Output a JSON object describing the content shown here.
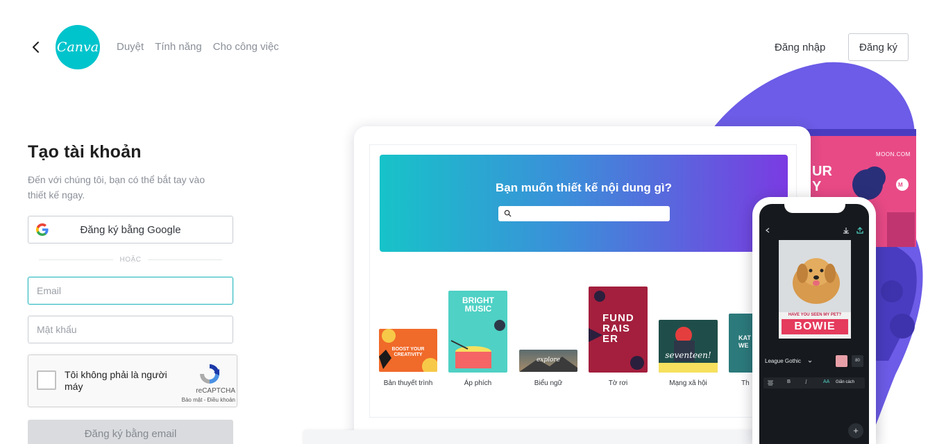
{
  "nav": {
    "logo_text": "Canva",
    "links": [
      "Duyệt",
      "Tính năng",
      "Cho công việc"
    ],
    "login": "Đăng nhập",
    "signup": "Đăng ký"
  },
  "form": {
    "title": "Tạo tài khoản",
    "subtitle": "Đến với chúng tôi, bạn có thể bắt tay vào thiết kế ngay.",
    "google_button": "Đăng ký bằng Google",
    "divider": "HOẶC",
    "email_placeholder": "Email",
    "password_placeholder": "Mật khẩu",
    "recaptcha": {
      "label": "Tôi không phải là người máy",
      "brand": "reCAPTCHA",
      "terms": "Bảo mật - Điều khoản"
    },
    "email_button": "Đăng ký bằng email"
  },
  "illustration": {
    "hero_title": "Bạn muốn thiết kế nội dung gì?",
    "tiles": [
      {
        "label": "Bản thuyết trình",
        "art_text": "BOOST YOUR CREATIVITY"
      },
      {
        "label": "Áp phích",
        "art_text": "BRIGHT MUSIC"
      },
      {
        "label": "Biểu ngữ",
        "art_text": "explore"
      },
      {
        "label": "Tờ rơi",
        "art_text": "FUND RAIS ER"
      },
      {
        "label": "Mạng xã hội",
        "art_text": "seventeen!"
      },
      {
        "label": "Th",
        "art_text": "KAT WE"
      }
    ],
    "back_card": {
      "site": "MOON.COM",
      "big_text": "UR Y",
      "badge": "M"
    },
    "phone": {
      "poster_question": "HAVE YOU SEEN MY PET?",
      "poster_name": "BOWIE",
      "font_name": "League Gothic",
      "font_size": "80",
      "toolbar_bold": "B",
      "toolbar_italic": "I",
      "toolbar_aa": "AA",
      "toolbar_spacing": "Giãn cách",
      "fab": "+"
    }
  },
  "colors": {
    "brand": "#00c4cc",
    "blob": "#6c5ce7",
    "hero_start": "#17c3c9",
    "hero_end": "#7a3be2",
    "pet_red": "#e53b5d"
  }
}
